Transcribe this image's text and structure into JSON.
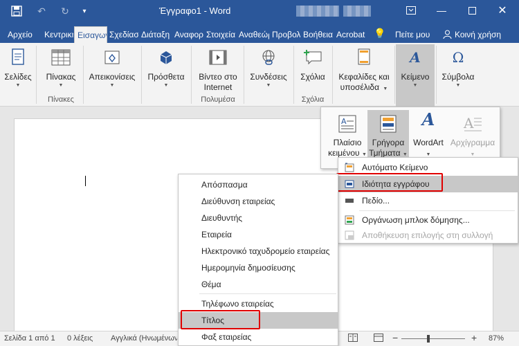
{
  "window": {
    "title": "Έγγραφο1 - Word",
    "minimize_icon": "minimize-icon",
    "restore_icon": "ribbon-display-icon",
    "maximize_icon": "maximize-icon",
    "close_icon": "close-icon"
  },
  "quick_access": [
    "save-icon",
    "undo-icon",
    "redo-icon",
    "customize-icon"
  ],
  "tabs": [
    {
      "label": "Αρχείο"
    },
    {
      "label": "Κεντρική"
    },
    {
      "label": "Εισαγωγή",
      "active": true
    },
    {
      "label": "Σχεδίαση"
    },
    {
      "label": "Διάταξη"
    },
    {
      "label": "Αναφορές"
    },
    {
      "label": "Στοιχεία"
    },
    {
      "label": "Αναθεώρηση"
    },
    {
      "label": "Προβολή"
    },
    {
      "label": "Βοήθεια"
    },
    {
      "label": "Acrobat"
    },
    {
      "label": "Πείτε μου"
    },
    {
      "label": "Κοινή χρήση"
    }
  ],
  "ribbon": {
    "pages": "Σελίδες",
    "table": "Πίνακας",
    "tables_group": "Πίνακες",
    "illustrations": "Απεικονίσεις",
    "addins": "Πρόσθετα",
    "video_line1": "Βίντεο στο",
    "video_line2": "Internet",
    "media_group": "Πολυμέσα",
    "links": "Συνδέσεις",
    "comment": "Σχόλια",
    "comments_group": "Σχόλια",
    "header_line1": "Κεφαλίδες και",
    "header_line2": "υποσέλιδα",
    "text": "Κείμενο",
    "symbols": "Σύμβολα"
  },
  "text_panel": {
    "textbox_line1": "Πλαίσιο",
    "textbox_line2": "κειμένου",
    "quickparts_line1": "Γρήγορα",
    "quickparts_line2": "Τμήματα",
    "wordart": "WordArt",
    "dropcap": "Αρχίγραμμα"
  },
  "quick_parts_menu": [
    {
      "label": "Αυτόματο Κείμενο",
      "icon": "autotext-icon"
    },
    {
      "label": "Ιδιότητα εγγράφου",
      "icon": "document-property-icon",
      "highlighted": true
    },
    {
      "label": "Πεδίο...",
      "icon": "field-icon"
    },
    {
      "label": "Οργάνωση μπλοκ δόμησης...",
      "icon": "building-blocks-icon"
    },
    {
      "label": "Αποθήκευση επιλογής στη συλλογή",
      "icon": "save-selection-icon",
      "disabled": true
    }
  ],
  "property_menu": [
    "Απόσπασμα",
    "Διεύθυνση εταιρείας",
    "Διευθυντής",
    "Εταιρεία",
    "Ηλεκτρονικό ταχυδρομείο εταιρείας",
    "Ημερομηνία δημοσίευσης",
    "Θέμα",
    "Τηλέφωνο εταιρείας",
    "Τίτλος",
    "Φαξ εταιρείας"
  ],
  "property_menu_highlighted": "Τίτλος",
  "status": {
    "page": "Σελίδα 1 από 1",
    "words": "0 λέξεις",
    "language": "Αγγλικά (Ηνωμένων",
    "zoom": "87%",
    "zoom_level": 0.87
  },
  "colors": {
    "accent": "#2b579a",
    "highlight_border": "#e00000",
    "hover": "#c8c8c8"
  }
}
